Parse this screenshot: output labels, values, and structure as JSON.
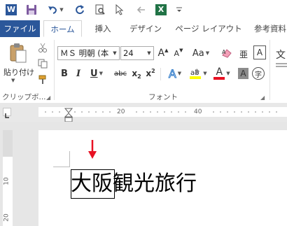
{
  "qat": {
    "word_icon_letter": "W",
    "excel_icon_letter": "X"
  },
  "tabs": [
    {
      "label": "ファイル"
    },
    {
      "label": "ホーム"
    },
    {
      "label": "挿入"
    },
    {
      "label": "デザイン"
    },
    {
      "label": "ページ レイアウト"
    },
    {
      "label": "参考資料"
    }
  ],
  "clipboard": {
    "paste_label": "貼り付け",
    "group_label": "クリップボ..."
  },
  "font": {
    "font_name": "ＭＳ 明朝 (本",
    "font_size": "24",
    "grow_label": "A",
    "shrink_label": "A",
    "case_label": "Aa",
    "bold": "B",
    "italic": "I",
    "underline": "U",
    "strike": "abc",
    "subscript": "x",
    "superscript": "x",
    "sub_mark": "2",
    "sup_mark": "2",
    "effects": "A",
    "font_color": "A",
    "char_shade": "A",
    "enclose": "字",
    "border_a": "A",
    "group_label": "フォント",
    "highlight_color": "#ffff00",
    "font_color_value": "#e81123"
  },
  "ruler": {
    "marks": [
      "20",
      "40"
    ]
  },
  "vruler": {
    "marks": [
      "10",
      "20"
    ]
  },
  "document": {
    "text_selected": "大阪",
    "text_rest": "観光旅行"
  },
  "colors": {
    "file_tab": "#2b579a",
    "arrow": "#e81123"
  }
}
